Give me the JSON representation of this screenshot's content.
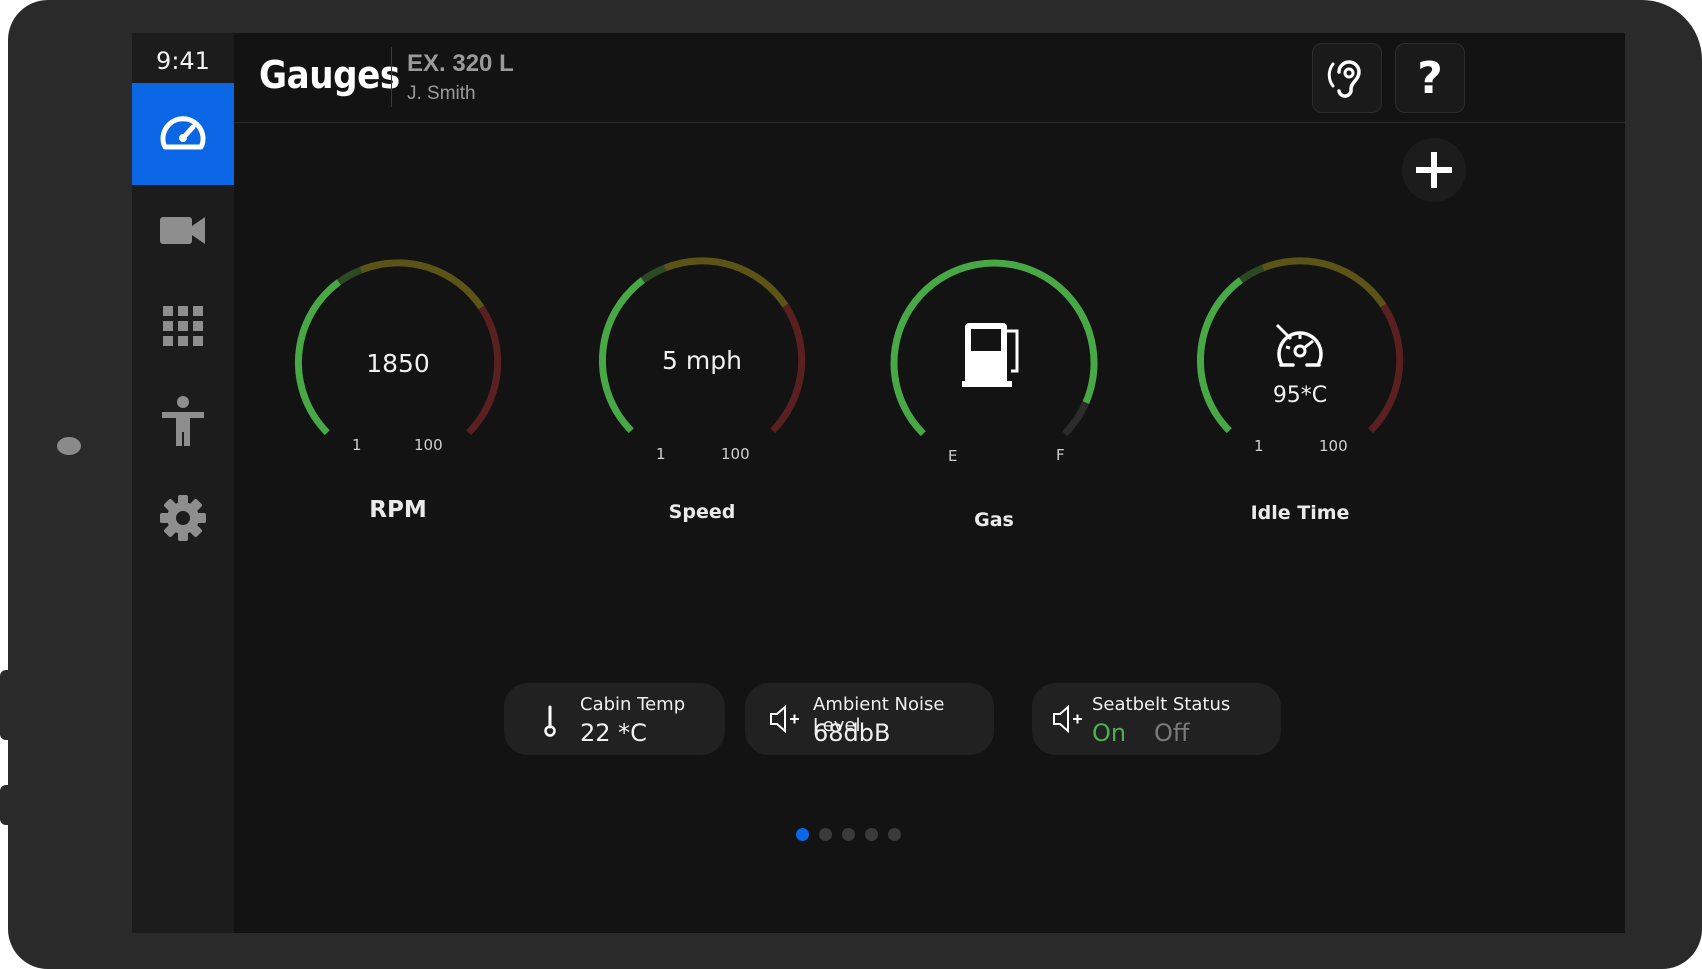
{
  "status_bar": {
    "time": "9:41"
  },
  "header": {
    "title": "Gauges",
    "machine": "EX. 320 L",
    "operator": "J. Smith",
    "hearing_icon": "ear-icon",
    "help_label": "?"
  },
  "sidebar": {
    "items": [
      {
        "icon": "speedometer-icon",
        "active": true
      },
      {
        "icon": "video-camera-icon",
        "active": false
      },
      {
        "icon": "apps-grid-icon",
        "active": false
      },
      {
        "icon": "accessibility-icon",
        "active": false
      },
      {
        "icon": "gear-icon",
        "active": false
      }
    ]
  },
  "add_button": {
    "icon": "plus-icon"
  },
  "gauges": [
    {
      "label": "RPM",
      "value": "1850",
      "min": "1",
      "max": "100"
    },
    {
      "label": "Speed",
      "value": "5 mph",
      "min": "1",
      "max": "100"
    },
    {
      "label": "Gas",
      "icon": "fuel-pump-icon",
      "min": "E",
      "max": "F",
      "level": 0.92
    },
    {
      "label": "Idle Time",
      "icon": "engine-idle-icon",
      "value": "95*C",
      "min": "1",
      "max": "100"
    }
  ],
  "cards": {
    "cabin_temp": {
      "title": "Cabin Temp",
      "value": "22 *C",
      "icon": "thermometer-icon"
    },
    "noise": {
      "title": "Ambient Noise Level",
      "value": "68dbB",
      "icon": "speaker-icon"
    },
    "seatbelt": {
      "title": "Seatbelt Status",
      "on": "On",
      "off": "Off",
      "selected": "On",
      "icon": "speaker-icon"
    }
  },
  "pagination": {
    "pages": 5,
    "current": 1
  },
  "colors": {
    "accent": "#0a66e4",
    "good": "#4caf50",
    "warn": "#6b5a14",
    "danger": "#5a1f1f",
    "on_text": "#4caf50",
    "off_text": "#7a7a7a"
  }
}
